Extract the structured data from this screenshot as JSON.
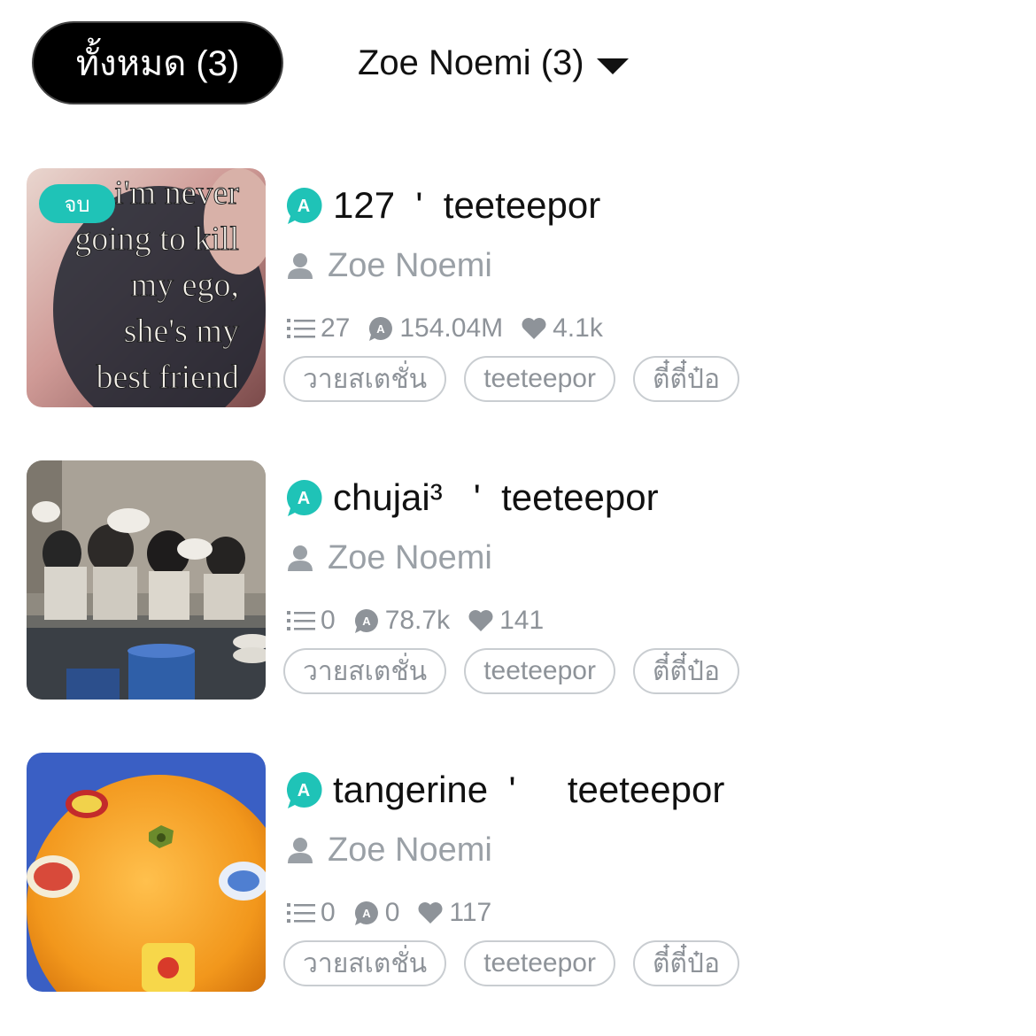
{
  "filters": {
    "all_label": "ทั้งหมด (3)",
    "author_label": "Zoe Noemi (3)"
  },
  "colors": {
    "accent": "#1fc3b7",
    "muted_text": "#9aa0a6",
    "tag_border": "#c9cdd1"
  },
  "items": [
    {
      "status_badge": "จบ",
      "cover_text": [
        "i'm never",
        "going to kill",
        "my ego,",
        "she's my",
        "best friend"
      ],
      "title": "127  '  teeteepor",
      "author": "Zoe Noemi",
      "chapters": "27",
      "views": "154.04M",
      "likes": "4.1k",
      "tags": [
        "วายสเตชั่น",
        "teeteepor",
        "ตี๋ตี๋ป๋อ"
      ]
    },
    {
      "title": "chujai³   '  teeteepor",
      "author": "Zoe Noemi",
      "chapters": "0",
      "views": "78.7k",
      "likes": "141",
      "tags": [
        "วายสเตชั่น",
        "teeteepor",
        "ตี๋ตี๋ป๋อ"
      ]
    },
    {
      "title": "tangerine  '     teeteepor",
      "author": "Zoe Noemi",
      "chapters": "0",
      "views": "0",
      "likes": "117",
      "tags": [
        "วายสเตชั่น",
        "teeteepor",
        "ตี๋ตี๋ป๋อ"
      ]
    }
  ]
}
